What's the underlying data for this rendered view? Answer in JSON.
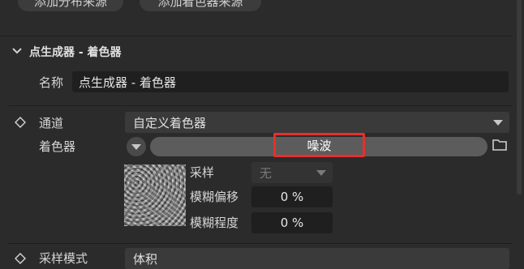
{
  "top_buttons": {
    "add_distribution_source": "添加分布来源",
    "add_shader_source": "添加着色器来源"
  },
  "section": {
    "title": "点生成器 - 着色器",
    "name_label": "名称",
    "name_value": "点生成器 - 着色器"
  },
  "channel": {
    "label": "通道",
    "value": "自定义着色器"
  },
  "shader": {
    "label": "着色器",
    "value": "噪波",
    "sampling_label": "采样",
    "sampling_value": "无",
    "blur_offset_label": "模糊偏移",
    "blur_offset_value": "0 %",
    "blur_amount_label": "模糊程度",
    "blur_amount_value": "0 %"
  },
  "bottom": {
    "sample_mode_label": "采样模式",
    "sample_mode_value": "体积"
  },
  "colors": {
    "highlight": "#e5312b",
    "background": "#2b2b2b"
  }
}
